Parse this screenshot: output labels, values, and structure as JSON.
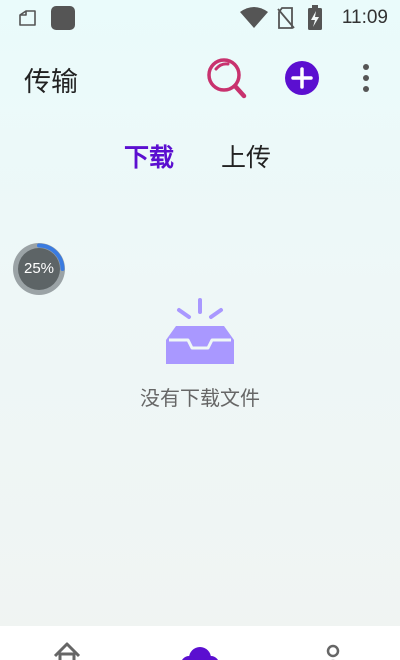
{
  "status_bar": {
    "time": "11:09",
    "icons": [
      "files-notification-icon",
      "app-notification-icon",
      "wifi-icon",
      "no-sim-icon",
      "battery-charging-icon"
    ]
  },
  "header": {
    "title": "传输",
    "actions": [
      "search-icon",
      "add-icon",
      "more-vertical-icon"
    ]
  },
  "tabs": {
    "download_label": "下载",
    "upload_label": "上传",
    "active": "download"
  },
  "progress": {
    "label": "25%",
    "value": 0.25
  },
  "empty_state": {
    "icon": "empty-inbox-icon",
    "message": "没有下载文件"
  },
  "bottom_nav": {
    "items": [
      "home-icon",
      "cloud-icon",
      "profile-icon"
    ],
    "active": "cloud-icon"
  },
  "colors": {
    "accent": "#5b0fd0",
    "search": "#c8326e",
    "inbox": "#a998ff",
    "progress_ring": "#3a7be0"
  }
}
